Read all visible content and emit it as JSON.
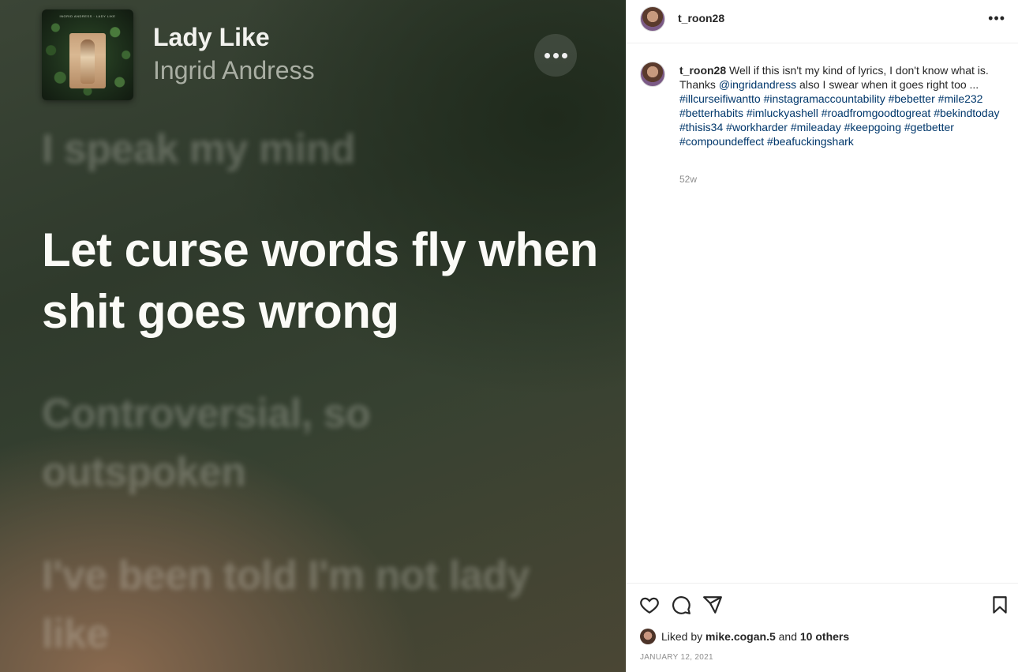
{
  "media": {
    "album_art_text": "INGRID ANDRESS · LADY LIKE",
    "song_title": "Lady Like",
    "song_artist": "Ingrid Andress",
    "lyrics": {
      "previous": "I speak my mind",
      "current": "Let curse words fly when shit goes wrong",
      "next_1": "Controversial, so outspoken",
      "next_2": "I've been told I'm not lady like"
    }
  },
  "post": {
    "username": "t_roon28",
    "caption": {
      "username": "t_roon28",
      "text_1": "Well if this isn't my kind of lyrics, I don't know what is. Thanks",
      "mention": "@ingridandress",
      "text_2": "also I swear when it goes right too ...",
      "hashtags": [
        "#illcurseifiwantto",
        "#instagramaccountability",
        "#bebetter",
        "#mile232",
        "#betterhabits",
        "#imluckyashell",
        "#roadfromgoodtogreat",
        "#bekindtoday",
        "#thisis34",
        "#workharder",
        "#mileaday",
        "#keepgoing",
        "#getbetter",
        "#compoundeffect",
        "#beafuckingshark"
      ]
    },
    "age": "52w",
    "likes": {
      "prefix": "Liked by",
      "liker": "mike.cogan.5",
      "conjunction": "and",
      "others": "10 others"
    },
    "date": "JANUARY 12, 2021"
  },
  "icons": {
    "more": "more-horizontal-icon",
    "like": "heart-icon",
    "comment": "comment-icon",
    "share": "paper-plane-icon",
    "save": "bookmark-icon"
  }
}
